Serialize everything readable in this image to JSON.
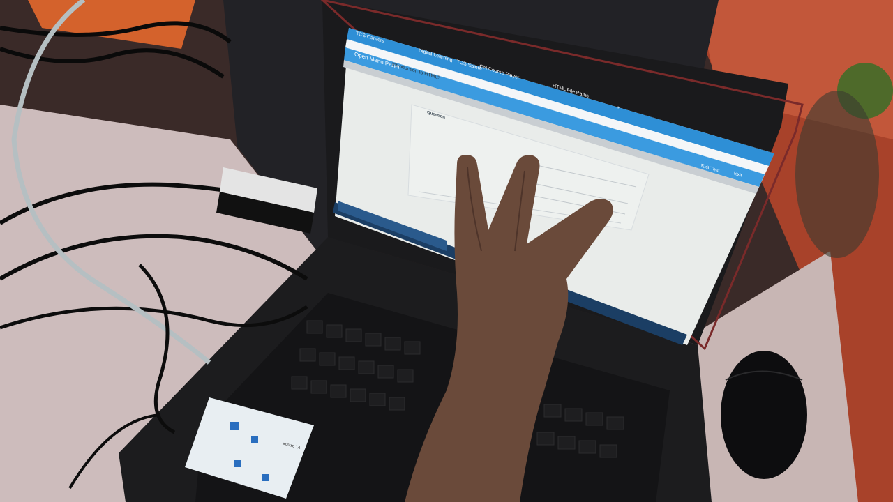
{
  "browser": {
    "tabs": [
      {
        "label": "TCS Careers"
      },
      {
        "label": "Digital Learning - TCS Spiore"
      },
      {
        "label": "iON Course Player"
      },
      {
        "label": "HTML File Paths"
      }
    ],
    "new_tab": "+"
  },
  "app": {
    "menu_button": "Open Menu Panel",
    "course_tab": "Introduction to HTML5",
    "exit_test": "Exit Test",
    "exit": "Exit"
  },
  "content": {
    "question_heading": "Question"
  },
  "sticker": {
    "model": "Vostro 14"
  },
  "colors": {
    "browser_bar": "#2e8fd6",
    "app_bar": "#3b9be0",
    "screen_bg": "#e9ecea",
    "laptop_body": "#1c1c1e",
    "desk": "#d8c8c6",
    "wall": "#b4462a"
  }
}
